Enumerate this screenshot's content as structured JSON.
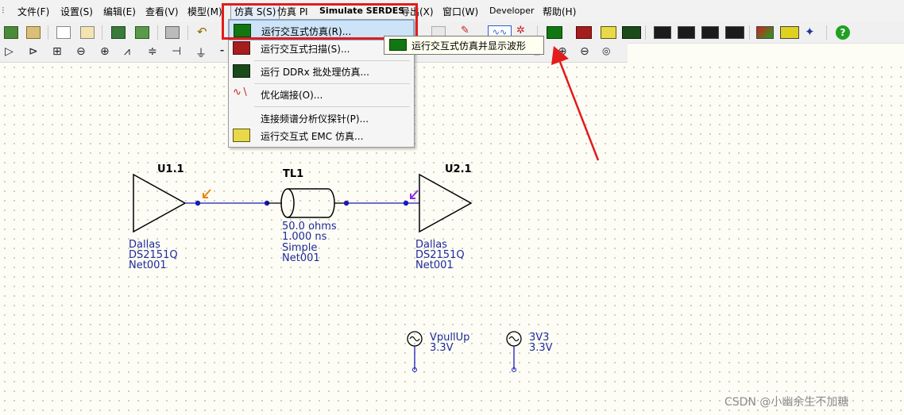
{
  "menubar": {
    "items": [
      {
        "label": "文件(F)"
      },
      {
        "label": "设置(S)"
      },
      {
        "label": "编辑(E)"
      },
      {
        "label": "查看(V)"
      },
      {
        "label": "模型(M)"
      },
      {
        "label": "仿真 S(S)"
      },
      {
        "label": "仿真 PI"
      },
      {
        "label": "Simulate SERDES"
      },
      {
        "label": "导出(X)"
      },
      {
        "label": "窗口(W)"
      },
      {
        "label": "Developer"
      },
      {
        "label": "帮助(H)"
      }
    ]
  },
  "sim_menu": {
    "items": [
      {
        "label": "运行交互式仿真(R)...",
        "icon": "oscilloscope-icon",
        "highlighted": true
      },
      {
        "label": "运行交互式扫描(S)...",
        "icon": "sweep-icon"
      },
      {
        "label": "运行 DDRx 批处理仿真...",
        "icon": "ddr-icon"
      },
      {
        "label": "优化端接(O)...",
        "icon": "optimize-icon"
      },
      {
        "label": "连接频谱分析仪探针(P)...",
        "icon": "probe-icon"
      },
      {
        "label": "运行交互式 EMC 仿真...",
        "icon": "emc-icon"
      }
    ]
  },
  "tooltip": {
    "text": "运行交互式仿真并显示波形"
  },
  "schematic": {
    "u1": {
      "ref": "U1.1",
      "vendor": "Dallas",
      "part": "DS2151Q",
      "net": "Net001"
    },
    "tl1": {
      "ref": "TL1",
      "impedance": "50.0 ohms",
      "delay": "1.000 ns",
      "type": "Simple",
      "net": "Net001"
    },
    "u2": {
      "ref": "U2.1",
      "vendor": "Dallas",
      "part": "DS2151Q",
      "net": "Net001"
    },
    "vpullup": {
      "name": "VpullUp",
      "value": "3.3V"
    },
    "v3v3": {
      "name": "3V3",
      "value": "3.3V"
    }
  },
  "watermark": "CSDN @小幽余生不加糖",
  "colors": {
    "annotation": "#e41b1b",
    "wire": "#1a1ab8",
    "label": "#1f2a9a"
  }
}
